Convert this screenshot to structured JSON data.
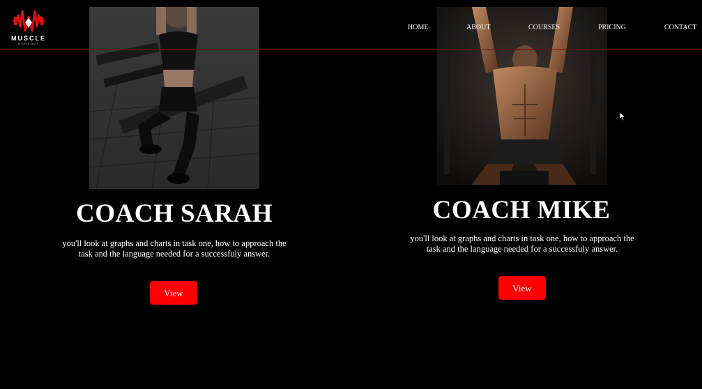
{
  "brand": {
    "name": "MUSCLE",
    "subtitle": "WORKOUT",
    "accent": "#ff0000"
  },
  "nav": {
    "items": [
      {
        "label": "HOME"
      },
      {
        "label": "ABOUT"
      },
      {
        "label": "COURSES"
      },
      {
        "label": "PRICING"
      },
      {
        "label": "CONTACT"
      }
    ]
  },
  "coaches": [
    {
      "name": "COACH SARAH",
      "description": "you'll look at graphs and charts in task one, how to approach the task and the language needed for a successfuly answer.",
      "button_label": "View"
    },
    {
      "name": "COACH MIKE",
      "description": "you'll look at graphs and charts in task one, how to approach the task and the language needed for a successfuly answer.",
      "button_label": "View"
    }
  ]
}
